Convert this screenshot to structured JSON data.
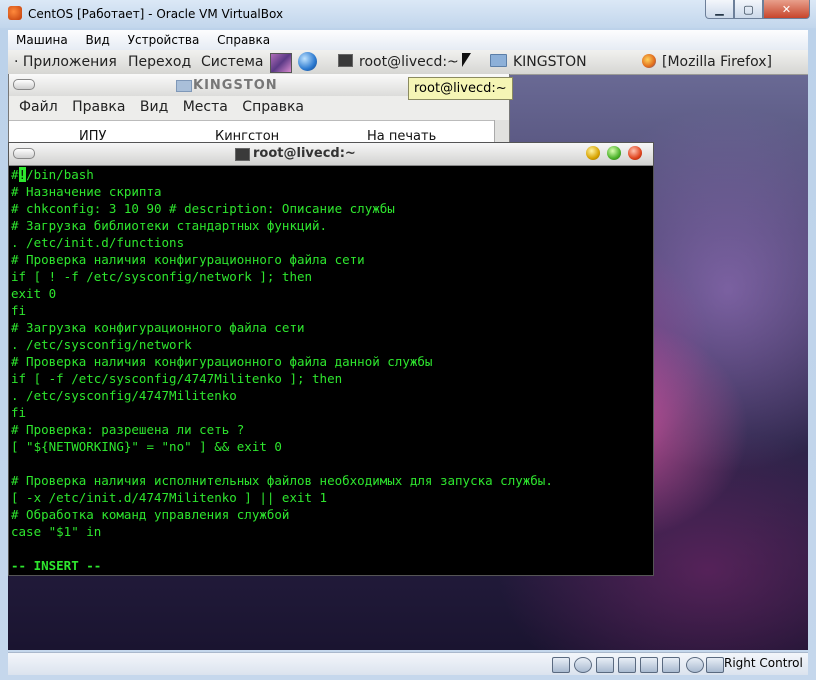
{
  "vb": {
    "title": "CentOS [Работает] - Oracle VM VirtualBox",
    "menu": [
      "Машина",
      "Вид",
      "Устройства",
      "Справка"
    ],
    "host_key": "Right Control"
  },
  "panel": {
    "items": [
      "· Приложения",
      "Переход",
      "Система"
    ],
    "tasks": [
      "root@livecd:~",
      "KINGSTON",
      "[Mozilla Firefox]"
    ]
  },
  "tooltip": "root@livecd:~",
  "kingston": {
    "title": "KINGSTON",
    "menu": [
      "Файл",
      "Правка",
      "Вид",
      "Места",
      "Справка"
    ],
    "columns": [
      "ИПУ",
      "Кингстон",
      "На печать"
    ]
  },
  "terminal": {
    "title": "root@livecd:~",
    "first_char": "#",
    "cursor_char": "!",
    "first_rest": "/bin/bash",
    "lines": [
      "# Назначение скрипта",
      "# chkconfig: 3 10 90 # description: Описание службы",
      "# Загрузка библиотеки стандартных функций.",
      ". /etc/init.d/functions",
      "# Проверка наличия конфигурационного файла сети",
      "if [ ! -f /etc/sysconfig/network ]; then",
      "exit 0",
      "fi",
      "# Загрузка конфигурационного файла сети",
      ". /etc/sysconfig/network",
      "# Проверка наличия конфигурационного файла данной службы",
      "if [ -f /etc/sysconfig/4747Militenko ]; then",
      ". /etc/sysconfig/4747Militenko",
      "fi",
      "# Проверка: разрешена ли сеть ?",
      "[ \"${NETWORKING}\" = \"no\" ] && exit 0",
      "",
      "# Проверка наличия исполнительных файлов необходимых для запуска службы.",
      "[ -x /etc/init.d/4747Militenko ] || exit 1",
      "# Обработка команд управления службой",
      "case \"$1\" in",
      ""
    ],
    "mode_line": "-- INSERT --"
  }
}
